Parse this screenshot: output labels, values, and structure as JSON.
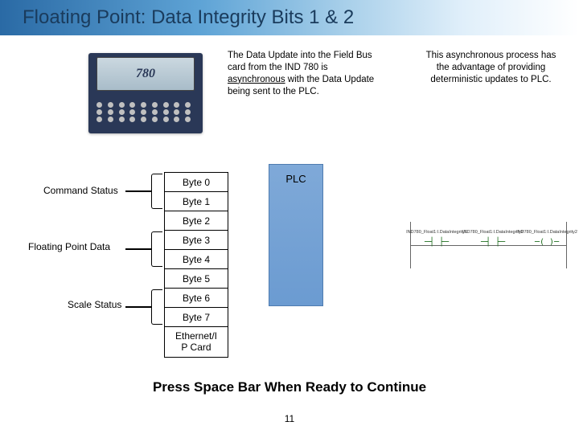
{
  "title": "Floating Point: Data Integrity Bits 1 & 2",
  "device_display": "780",
  "para1_a": "The Data Update into the Field Bus card from the IND 780 is ",
  "para1_u": "asynchronous",
  "para1_b": " with the Data Update being sent to the PLC.",
  "para2": "This asynchronous process has the advantage of providing deterministic updates to PLC.",
  "labels": {
    "cmd": "Command Status",
    "fp": "Floating Point Data",
    "sc": "Scale Status"
  },
  "bytes": [
    "Byte 0",
    "Byte 1",
    "Byte 2",
    "Byte 3",
    "Byte 4",
    "Byte 5",
    "Byte 6",
    "Byte 7",
    "Ethernet/I\nP Card"
  ],
  "plc": "PLC",
  "ladder_labels": [
    "IND780_Float1:I.DataIntegrity1",
    "IND780_Float1:I.DataIntegrity2",
    "IND780_Float1:I.DataIntegrity2"
  ],
  "footer_press": "Press Space Bar When Ready to Continue",
  "page_num": "11"
}
